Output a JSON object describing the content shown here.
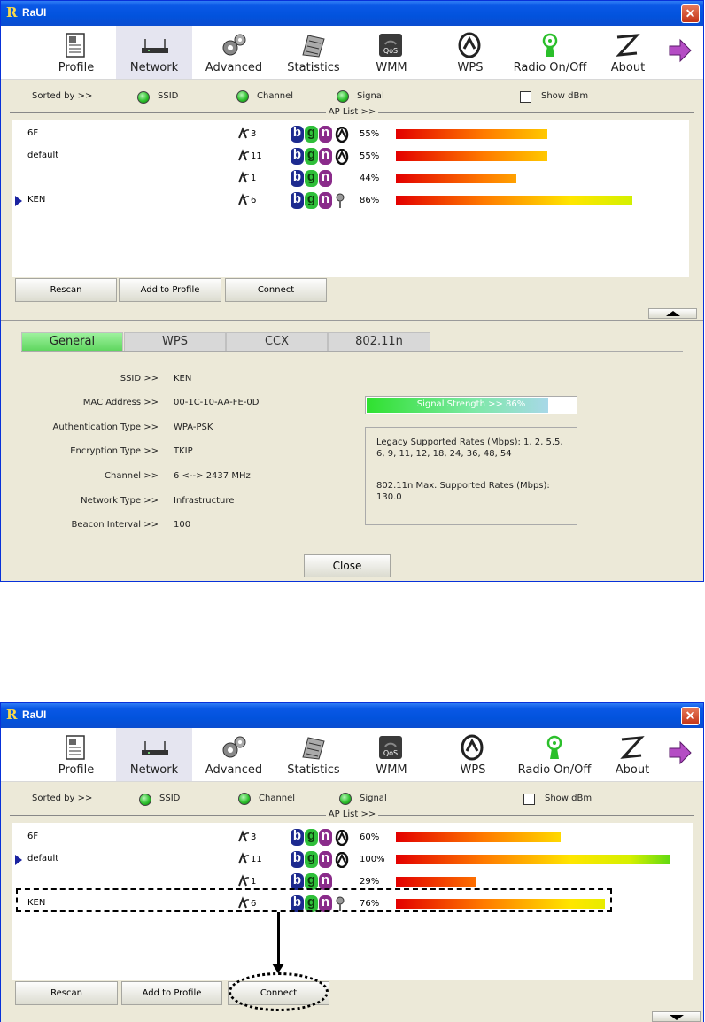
{
  "title": "RaUI",
  "close_glyph": "✕",
  "toolbar": {
    "items": [
      {
        "label": "Profile",
        "icon": "profile-icon"
      },
      {
        "label": "Network",
        "icon": "network-icon"
      },
      {
        "label": "Advanced",
        "icon": "advanced-gear-icon"
      },
      {
        "label": "Statistics",
        "icon": "statistics-icon"
      },
      {
        "label": "WMM",
        "icon": "qos-icon"
      },
      {
        "label": "WPS",
        "icon": "wps-icon"
      },
      {
        "label": "Radio On/Off",
        "icon": "radio-antenna-icon"
      },
      {
        "label": "About",
        "icon": "about-icon"
      }
    ]
  },
  "sort": {
    "label": "Sorted by >>",
    "ssid": "SSID",
    "channel": "Channel",
    "signal": "Signal",
    "show_dbm": "Show dBm",
    "ap_list_caption": "AP List >>"
  },
  "mode_letters": {
    "b": "b",
    "g": "g",
    "n": "n"
  },
  "buttons": {
    "rescan": "Rescan",
    "add_to_profile": "Add to Profile",
    "connect": "Connect",
    "close": "Close"
  },
  "window1": {
    "ap_list": [
      {
        "ssid": "6F",
        "channel": "3",
        "modes": "bgn",
        "security": "wps",
        "signal": "55%",
        "signal_pct": 55,
        "selected": false
      },
      {
        "ssid": "default",
        "channel": "11",
        "modes": "bgn",
        "security": "wps",
        "signal": "55%",
        "signal_pct": 55,
        "selected": false
      },
      {
        "ssid": "",
        "channel": "1",
        "modes": "bgn",
        "security": "none",
        "signal": "44%",
        "signal_pct": 44,
        "selected": false
      },
      {
        "ssid": "KEN",
        "channel": "6",
        "modes": "bgn",
        "security": "key",
        "signal": "86%",
        "signal_pct": 86,
        "selected": true
      }
    ],
    "tabs": [
      "General",
      "WPS",
      "CCX",
      "802.11n"
    ],
    "details": {
      "labels": [
        "SSID >>",
        "MAC Address >>",
        "Authentication Type >>",
        "Encryption Type >>",
        "Channel >>",
        "Network Type >>",
        "Beacon Interval >>"
      ],
      "values": [
        "KEN",
        "00-1C-10-AA-FE-0D",
        "WPA-PSK",
        "TKIP",
        "6 <--> 2437 MHz",
        "Infrastructure",
        "100"
      ]
    },
    "signal_strength": {
      "text": "Signal Strength >> 86%",
      "pct": 86
    },
    "rates": {
      "legacy": "Legacy Supported Rates (Mbps): 1, 2, 5.5, 6, 9, 11, 12, 18, 24, 36, 48, 54",
      "ht": "802.11n Max. Supported Rates (Mbps): 130.0"
    }
  },
  "window2": {
    "ap_list": [
      {
        "ssid": "6F",
        "channel": "3",
        "modes": "bgn",
        "security": "wps",
        "signal": "60%",
        "signal_pct": 60,
        "selected": false
      },
      {
        "ssid": "default",
        "channel": "11",
        "modes": "bgn",
        "security": "wps",
        "signal": "100%",
        "signal_pct": 100,
        "selected": true
      },
      {
        "ssid": "",
        "channel": "1",
        "modes": "bgn",
        "security": "none",
        "signal": "29%",
        "signal_pct": 29,
        "selected": false
      },
      {
        "ssid": "KEN",
        "channel": "6",
        "modes": "bgn",
        "security": "key",
        "signal": "76%",
        "signal_pct": 76,
        "selected": false
      }
    ]
  }
}
